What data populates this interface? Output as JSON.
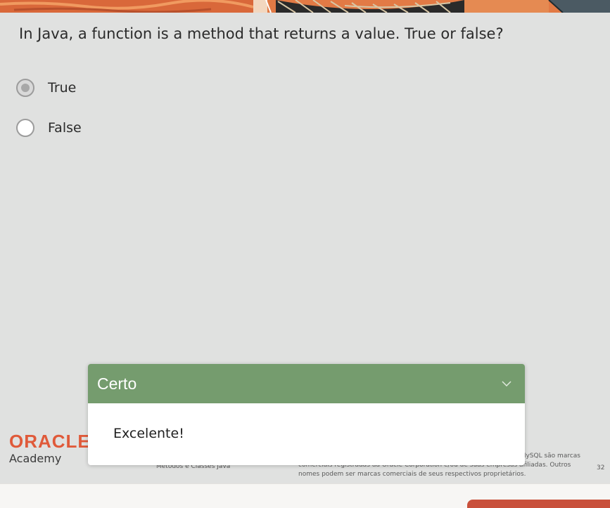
{
  "question": {
    "text": "In Java, a function is a method that returns a value. True or false?"
  },
  "options": [
    {
      "label": "True",
      "selected": true
    },
    {
      "label": "False",
      "selected": false
    }
  ],
  "feedback": {
    "title": "Certo",
    "message": "Excelente!",
    "header_color": "#759c6e",
    "toggle_icon": "chevron-down-icon"
  },
  "footer": {
    "brand": "ORACLE",
    "sub_brand": "Academy",
    "course": "Métodos e Classes Java",
    "legal_line1": "MySQL são marcas",
    "legal_line2": "comerciais registradas da Oracle Corporation e/ou de suas empresas afiliadas. Outros",
    "legal_line3": "nomes podem ser marcas comerciais de seus respectivos proprietários.",
    "page_number": "32",
    "brand_color": "#e05a3a"
  },
  "colors": {
    "slide_background": "#e0e1e0",
    "submit_button": "#c9503b"
  }
}
